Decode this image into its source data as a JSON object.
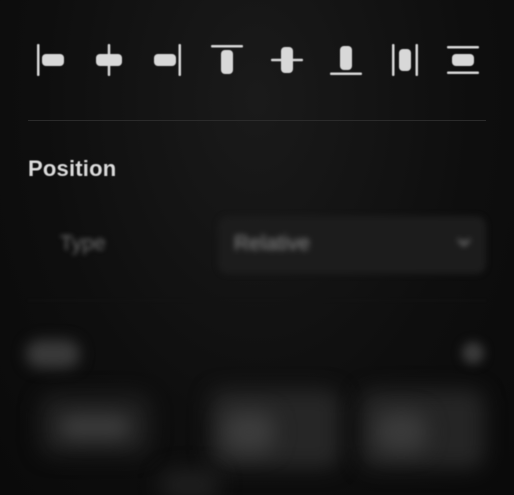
{
  "toolbar": {
    "buttons": [
      {
        "name": "align-left-icon"
      },
      {
        "name": "align-horizontal-center-icon"
      },
      {
        "name": "align-right-icon"
      },
      {
        "name": "align-top-icon"
      },
      {
        "name": "align-vertical-center-icon"
      },
      {
        "name": "align-bottom-icon"
      },
      {
        "name": "distribute-horizontal-icon"
      },
      {
        "name": "distribute-vertical-icon"
      }
    ]
  },
  "position": {
    "title": "Position",
    "type_label": "Type",
    "type_value": "Relative"
  },
  "colors": {
    "background": "#0c0c0c",
    "icon": "#d8d8d8",
    "title": "#dcdcdc"
  }
}
